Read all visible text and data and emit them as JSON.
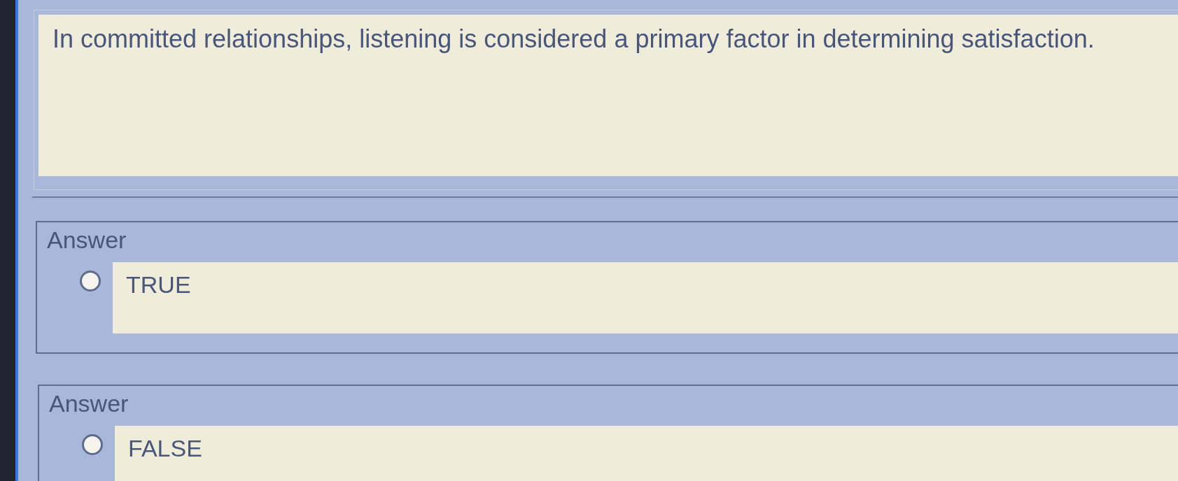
{
  "question": {
    "text": "In committed relationships, listening is considered a primary factor in determining satisfaction."
  },
  "answers": [
    {
      "legend": "Answer",
      "label": "TRUE",
      "selected": false
    },
    {
      "legend": "Answer",
      "label": "FALSE",
      "selected": false
    }
  ]
}
